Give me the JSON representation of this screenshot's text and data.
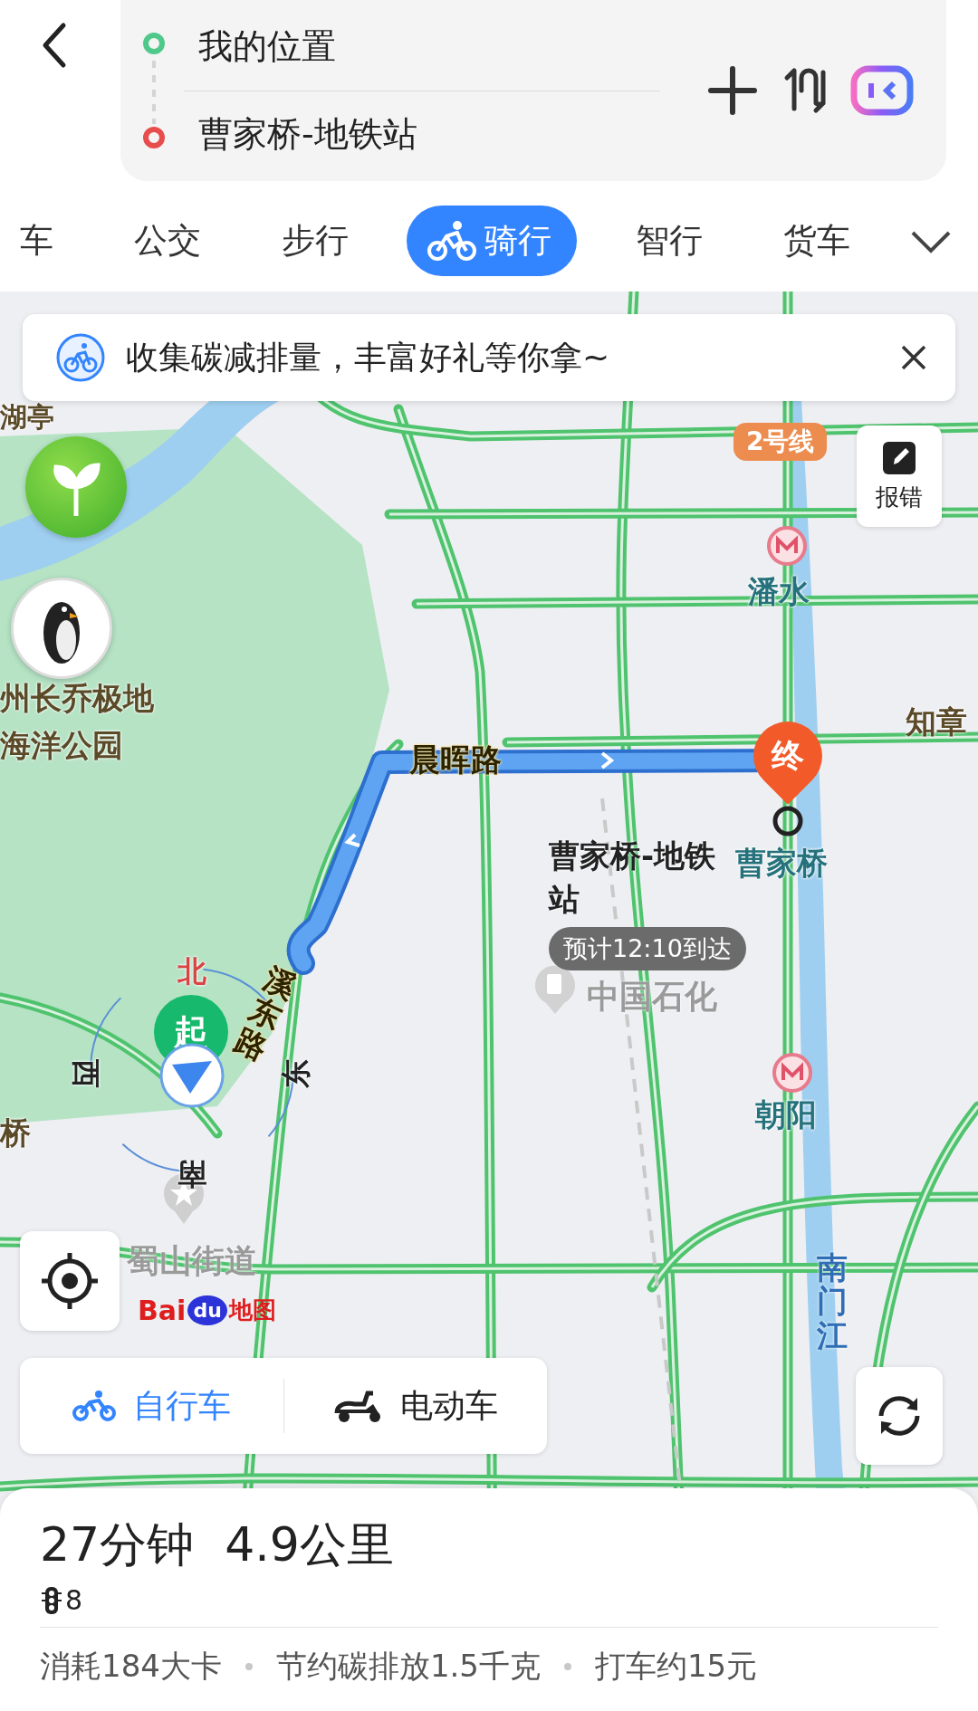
{
  "route": {
    "origin": "我的位置",
    "destination": "曹家桥-地铁站"
  },
  "tabs": [
    {
      "label": "车",
      "selected": false
    },
    {
      "label": "公交",
      "selected": false
    },
    {
      "label": "步行",
      "selected": false
    },
    {
      "label": "骑行",
      "selected": true
    },
    {
      "label": "智行",
      "selected": false
    },
    {
      "label": "货车",
      "selected": false
    }
  ],
  "banner": {
    "text": "收集碳减排量，丰富好礼等你拿~"
  },
  "map": {
    "line_badge": "2号线",
    "report_button": "报错",
    "destination_marker": "终",
    "start_marker": "起",
    "destination_name": "曹家桥-地铁站",
    "eta": "预计12:10到达",
    "compass": {
      "north": "北",
      "west": "西",
      "east": "东",
      "south": "南"
    },
    "labels": [
      {
        "text": "湖亭",
        "kind": "place"
      },
      {
        "text": "州长乔极地",
        "kind": "place"
      },
      {
        "text": "海洋公园",
        "kind": "place"
      },
      {
        "text": "潘水",
        "kind": "metro"
      },
      {
        "text": "晨晖路",
        "kind": "road"
      },
      {
        "text": "曹家桥",
        "kind": "metro"
      },
      {
        "text": "中国石化",
        "kind": "poi"
      },
      {
        "text": "朝阳",
        "kind": "metro"
      },
      {
        "text": "南门江",
        "kind": "water"
      },
      {
        "text": "知章",
        "kind": "place"
      },
      {
        "text": "桥",
        "kind": "place"
      },
      {
        "text": "溪东路",
        "kind": "road"
      },
      {
        "text": "蜀山街道",
        "kind": "poi"
      }
    ],
    "logo": {
      "part_1": "Bai",
      "part_2": "du",
      "part_3": "地图"
    }
  },
  "vehicle_modes": [
    {
      "label": "自行车",
      "selected": true
    },
    {
      "label": "电动车",
      "selected": false
    }
  ],
  "summary": {
    "duration": "27分钟",
    "distance": "4.9公里",
    "traffic_lights": "8",
    "stats": [
      "消耗184大卡",
      "节约碳排放1.5千克",
      "打车约15元"
    ]
  }
}
